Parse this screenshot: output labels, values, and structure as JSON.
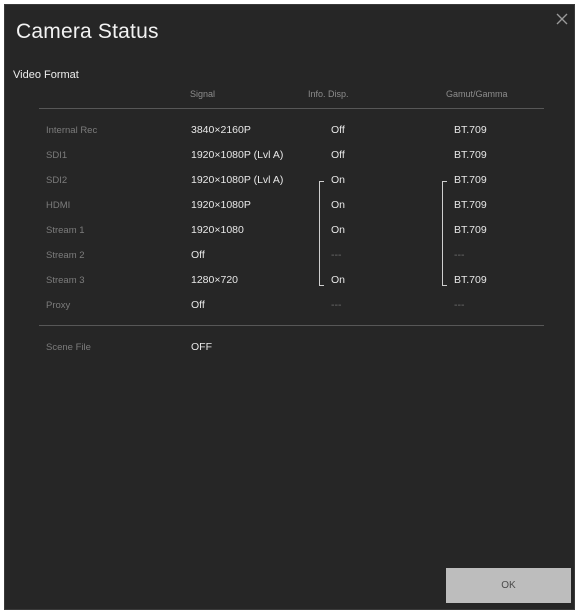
{
  "dialog": {
    "title": "Camera Status",
    "section_title": "Video Format",
    "ok_label": "OK"
  },
  "columns": {
    "signal": "Signal",
    "info": "Info. Disp.",
    "gamut": "Gamut/Gamma"
  },
  "rows": [
    {
      "label": "Internal Rec",
      "signal": "3840×2160P",
      "info": "Off",
      "gamut": "BT.709"
    },
    {
      "label": "SDI1",
      "signal": "1920×1080P (Lvl A)",
      "info": "Off",
      "gamut": "BT.709"
    },
    {
      "label": "SDI2",
      "signal": "1920×1080P (Lvl A)",
      "info": "On",
      "gamut": "BT.709"
    },
    {
      "label": "HDMI",
      "signal": "1920×1080P",
      "info": "On",
      "gamut": "BT.709"
    },
    {
      "label": "Stream 1",
      "signal": "1920×1080",
      "info": "On",
      "gamut": "BT.709"
    },
    {
      "label": "Stream 2",
      "signal": "Off",
      "info": "---",
      "gamut": "---"
    },
    {
      "label": "Stream 3",
      "signal": "1280×720",
      "info": "On",
      "gamut": "BT.709"
    },
    {
      "label": "Proxy",
      "signal": "Off",
      "info": "---",
      "gamut": "---"
    }
  ],
  "scene_file": {
    "label": "Scene File",
    "value": "OFF"
  },
  "colors": {
    "dialog_bg": "#262626",
    "ok_button_bg": "#bdbdbd"
  }
}
